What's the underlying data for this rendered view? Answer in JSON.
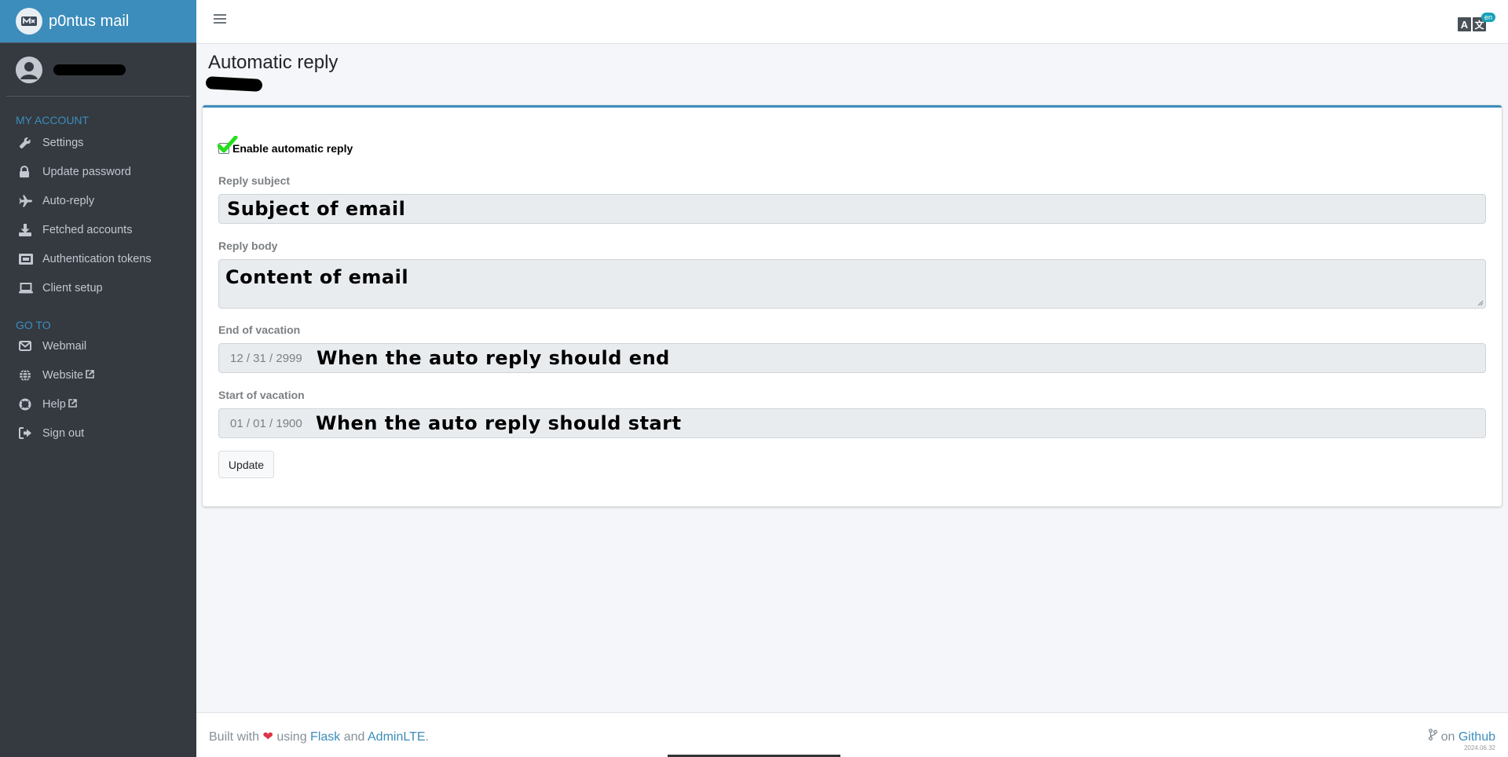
{
  "brand": {
    "name": "p0ntus mail"
  },
  "sidebar": {
    "sections": [
      {
        "header": "MY ACCOUNT",
        "items": [
          {
            "label": "Settings",
            "icon": "wrench-icon"
          },
          {
            "label": "Update password",
            "icon": "lock-icon"
          },
          {
            "label": "Auto-reply",
            "icon": "plane-icon"
          },
          {
            "label": "Fetched accounts",
            "icon": "download-icon"
          },
          {
            "label": "Authentication tokens",
            "icon": "ticket-icon"
          },
          {
            "label": "Client setup",
            "icon": "laptop-icon"
          }
        ]
      },
      {
        "header": "GO TO",
        "items": [
          {
            "label": "Webmail",
            "icon": "envelope-icon"
          },
          {
            "label": "Website",
            "icon": "globe-icon"
          },
          {
            "label": "Help",
            "icon": "life-ring-icon"
          },
          {
            "label": "Sign out",
            "icon": "sign-out-icon"
          }
        ]
      }
    ]
  },
  "navbar": {
    "language_badge": "en"
  },
  "page": {
    "title": "Automatic reply"
  },
  "form": {
    "enable_label": "Enable automatic reply",
    "enable_checked": true,
    "subject_label": "Reply subject",
    "subject_value": "Subject of email",
    "body_label": "Reply body",
    "body_value": "Content of email",
    "end_label": "End of vacation",
    "end_date": "12 / 31 / 2999",
    "end_annotation": "When the auto reply should end",
    "start_label": "Start of vacation",
    "start_date": "01 / 01 / 1900",
    "start_annotation": "When the auto reply should start",
    "submit_label": "Update"
  },
  "footer": {
    "built_with": "Built with",
    "using": "using",
    "flask": "Flask",
    "and": "and",
    "adminlte": "AdminLTE",
    "period": ".",
    "on": "on",
    "github": "Github",
    "version": "2024.06.32"
  },
  "colors": {
    "accent": "#3c8dbc",
    "sidebar_bg": "#343a40",
    "check_green": "#22e01a"
  }
}
